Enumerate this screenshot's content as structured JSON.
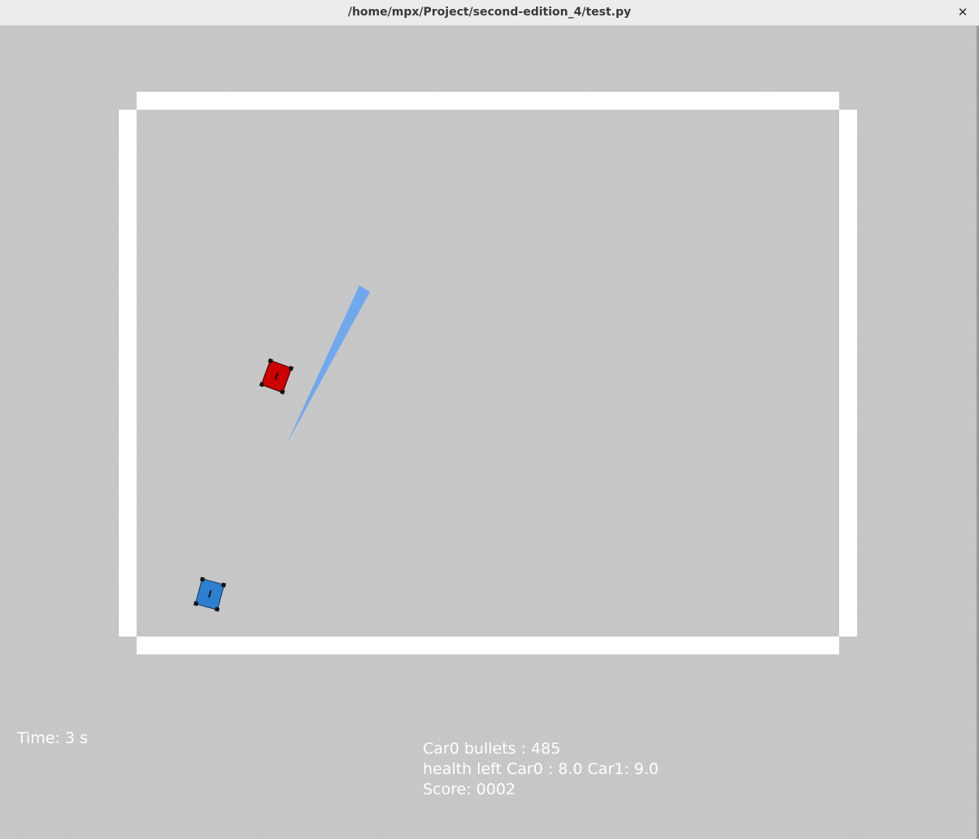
{
  "window": {
    "title": "/home/mpx/Project/second-edition_4/test.py",
    "close_icon": "close-icon",
    "close_glyph": "✕"
  },
  "game": {
    "wall_color": "#ffffff",
    "floor_color": "#c8c8c8",
    "car0": {
      "name": "Car0",
      "color": "#cc0000",
      "icon": "red-car-icon"
    },
    "car1": {
      "name": "Car1",
      "color": "#2f7fd0",
      "icon": "blue-car-icon"
    },
    "laser": {
      "color": "#6fa8ee",
      "icon": "laser-beam-icon"
    }
  },
  "hud": {
    "time": "Time: 3 s",
    "bullets": "Car0 bullets : 485",
    "health": "health left Car0 : 8.0 Car1: 9.0",
    "score": "Score: 0002",
    "text_color": "#ffffff"
  }
}
